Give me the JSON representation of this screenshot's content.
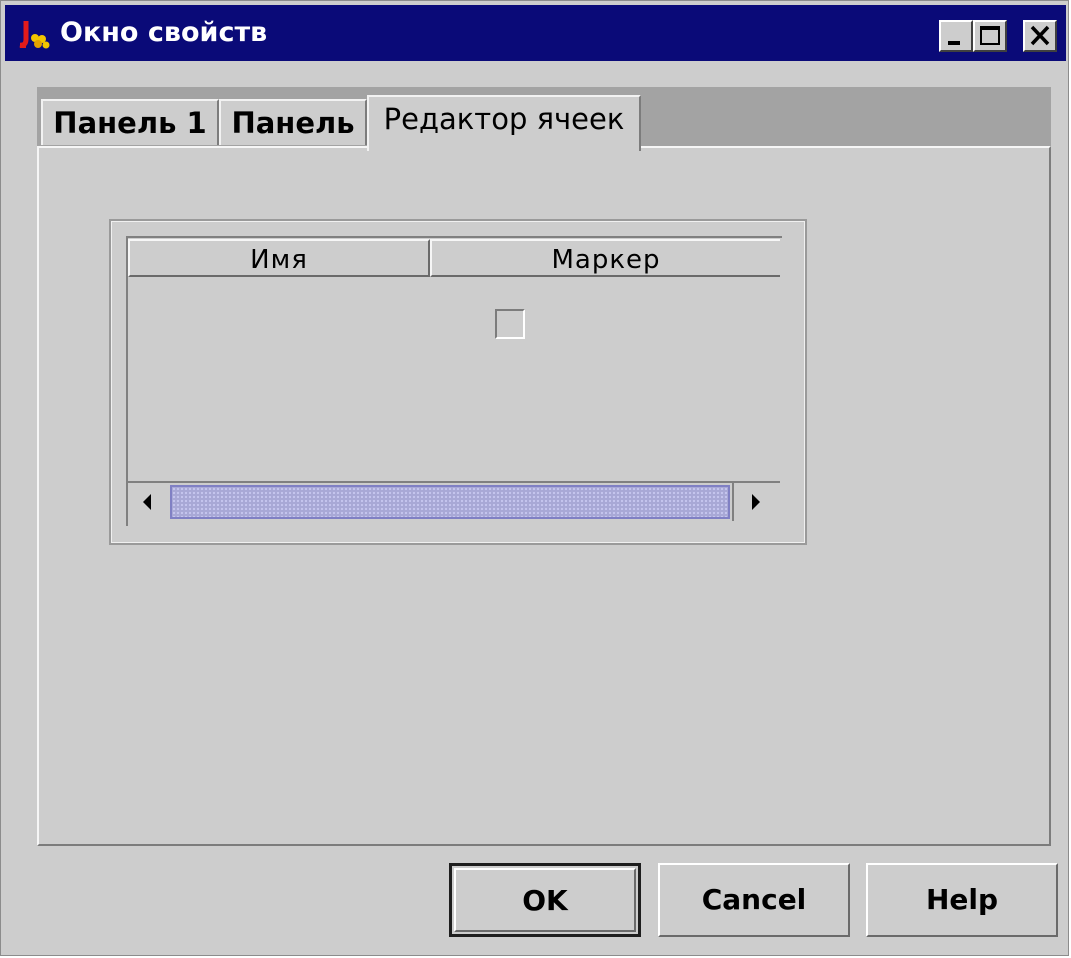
{
  "window": {
    "title": "Окно свойств",
    "icon": "java-app-icon",
    "controls": [
      "minimize-icon",
      "maximize-icon",
      "close-icon"
    ]
  },
  "tabs": [
    {
      "label": "Панель 1",
      "selected": false
    },
    {
      "label": "Панель",
      "selected": false
    },
    {
      "label": "Редактор ячеек",
      "selected": true
    }
  ],
  "table": {
    "columns": [
      "Имя",
      "Маркер"
    ],
    "rows": [
      {
        "name": "",
        "marker_checked": false
      }
    ]
  },
  "scrollbar": {
    "left_arrow": "arrow-left-icon",
    "right_arrow": "arrow-right-icon",
    "thumb_color": "#a8a8d6"
  },
  "buttons": {
    "ok": "OK",
    "cancel": "Cancel",
    "help": "Help"
  },
  "colors": {
    "titlebar": "#0a0a78",
    "window_bg": "#cdcdcd",
    "tab_strip": "#a3a3a3"
  }
}
